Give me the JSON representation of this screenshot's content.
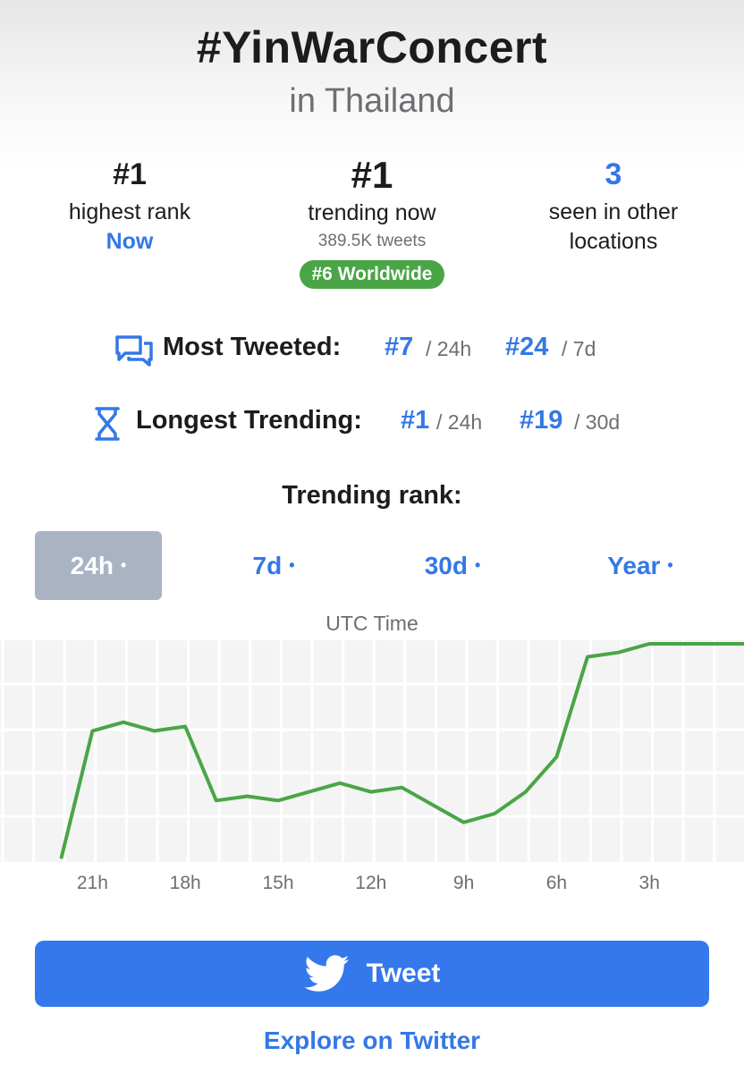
{
  "header": {
    "title": "#YinWarConcert",
    "subtitle": "in Thailand"
  },
  "stats": {
    "highest": {
      "value": "#1",
      "label": "highest rank",
      "when": "Now"
    },
    "trending": {
      "value": "#1",
      "label": "trending now",
      "tweets": "389.5K tweets",
      "badge": "#6 Worldwide"
    },
    "locations": {
      "value": "3",
      "label_line1": "seen in other",
      "label_line2": "locations"
    }
  },
  "most_tweeted": {
    "icon": "chat-bubbles-icon",
    "label": "Most Tweeted:",
    "rank_24h": "#7",
    "period_24h": "/ 24h",
    "rank_7d": "#24",
    "period_7d": "/ 7d"
  },
  "longest_trending": {
    "icon": "hourglass-icon",
    "label": "Longest Trending:",
    "rank_24h": "#1",
    "period_24h": "/ 24h",
    "rank_30d": "#19",
    "period_30d": "/ 30d"
  },
  "trending_rank_title": "Trending rank:",
  "tabs": [
    {
      "label": "24h",
      "dot": "•",
      "active": true
    },
    {
      "label": "7d",
      "dot": "•",
      "active": false
    },
    {
      "label": "30d",
      "dot": "•",
      "active": false
    },
    {
      "label": "Year",
      "dot": "•",
      "active": false
    }
  ],
  "colors": {
    "accent": "#3478e6",
    "line": "#4aa547",
    "badge": "#4aa547",
    "active_tab": "#a9b3c1",
    "button": "#3578ec"
  },
  "chart_data": {
    "type": "line",
    "xlabel": "UTC Time",
    "x_tick_labels": [
      "21h",
      "18h",
      "15h",
      "12h",
      "9h",
      "6h",
      "3h"
    ],
    "x_tick_hours_ago": [
      21,
      18,
      15,
      12,
      9,
      6,
      3
    ],
    "hours_ago": [
      22,
      21,
      20,
      19,
      18,
      17,
      16,
      15,
      14,
      13,
      12,
      11,
      10,
      9,
      8,
      7,
      6,
      5,
      4,
      3,
      2,
      1,
      0
    ],
    "series": [
      {
        "values": [
          50,
          21,
          19,
          21,
          20,
          37,
          36,
          37,
          35,
          33,
          35,
          34,
          38,
          42,
          40,
          35,
          27,
          4,
          3,
          1,
          1,
          1,
          1
        ]
      }
    ],
    "y_axis": "rank (lower is better), not labeled",
    "grid": true,
    "legend": "none"
  },
  "tweet_button": {
    "icon": "twitter-bird-icon",
    "label": "Tweet"
  },
  "explore_link": "Explore on Twitter"
}
